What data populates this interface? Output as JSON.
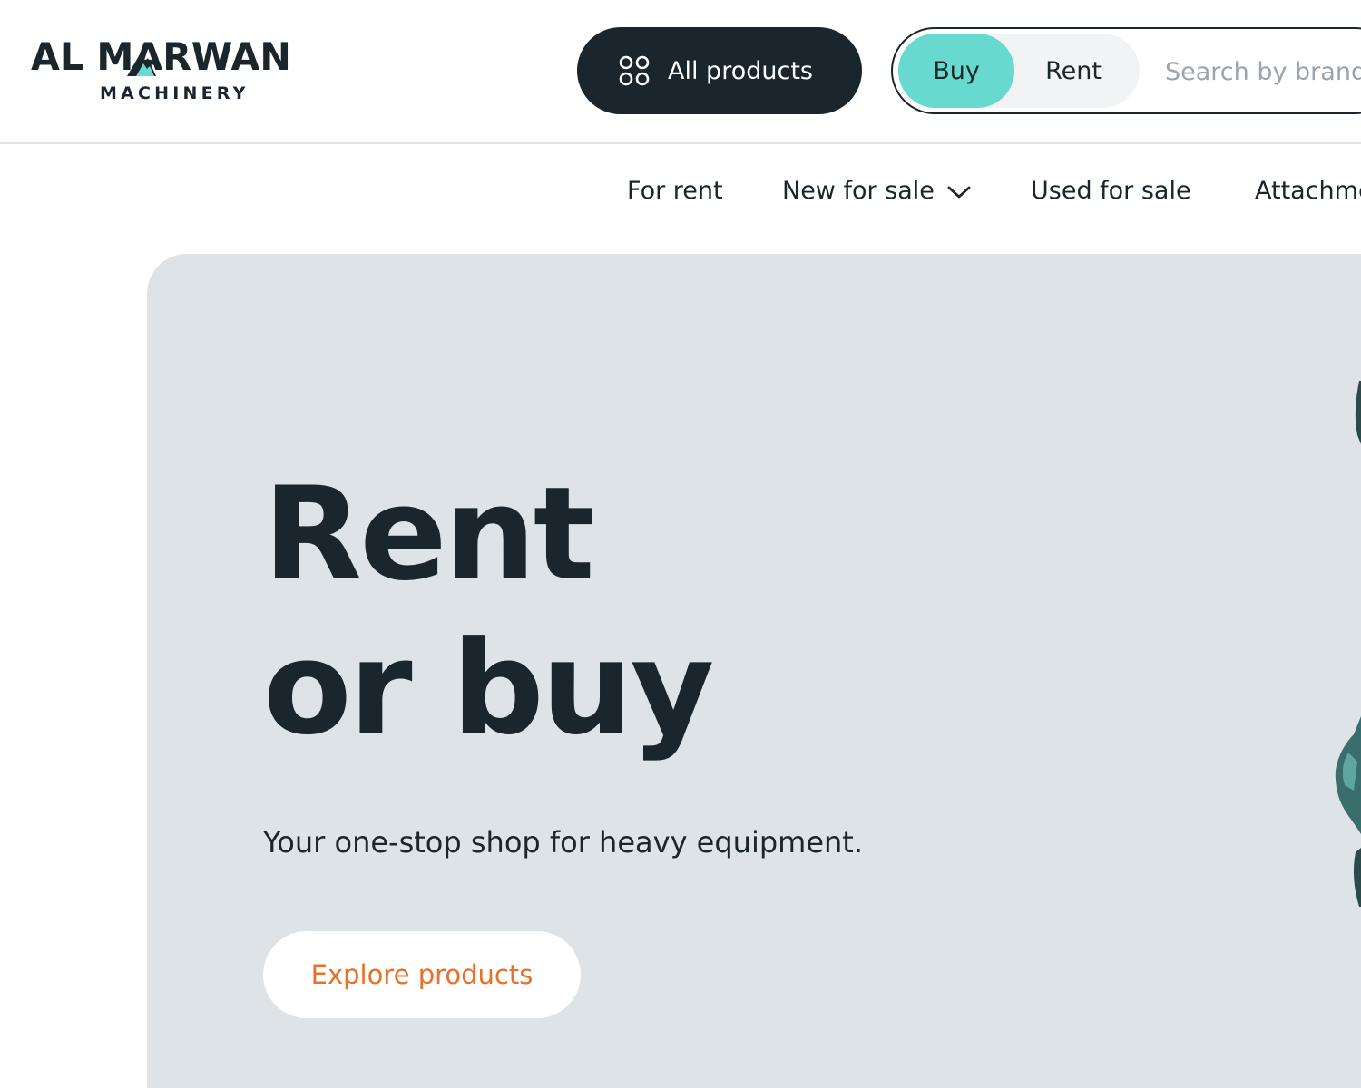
{
  "brand": {
    "name_primary": "AL MARWAN",
    "name_secondary": "MACHINERY"
  },
  "header": {
    "all_products_label": "All products",
    "mode_toggle": {
      "options": [
        "Buy",
        "Rent"
      ],
      "selected": "Buy"
    },
    "search": {
      "placeholder": "Search by brand",
      "value": ""
    }
  },
  "nav": {
    "items": [
      {
        "label": "For rent",
        "has_dropdown": false
      },
      {
        "label": "New for sale",
        "has_dropdown": true
      },
      {
        "label": "Used for sale",
        "has_dropdown": false
      },
      {
        "label": "Attachments",
        "has_dropdown": false
      }
    ]
  },
  "hero": {
    "title_line_1": "Rent",
    "title_line_2": "or buy",
    "subtitle": "Your one-stop shop for heavy equipment.",
    "cta_label": "Explore products"
  },
  "icons": {
    "all_products": "grid-icon",
    "dropdown": "chevron-down-icon"
  },
  "colors": {
    "dark": "#1a262b",
    "accent_teal": "#67d9cf",
    "accent_orange": "#e8702a",
    "hero_bg": "#dee3e7",
    "placeholder": "#9aa3b0"
  }
}
